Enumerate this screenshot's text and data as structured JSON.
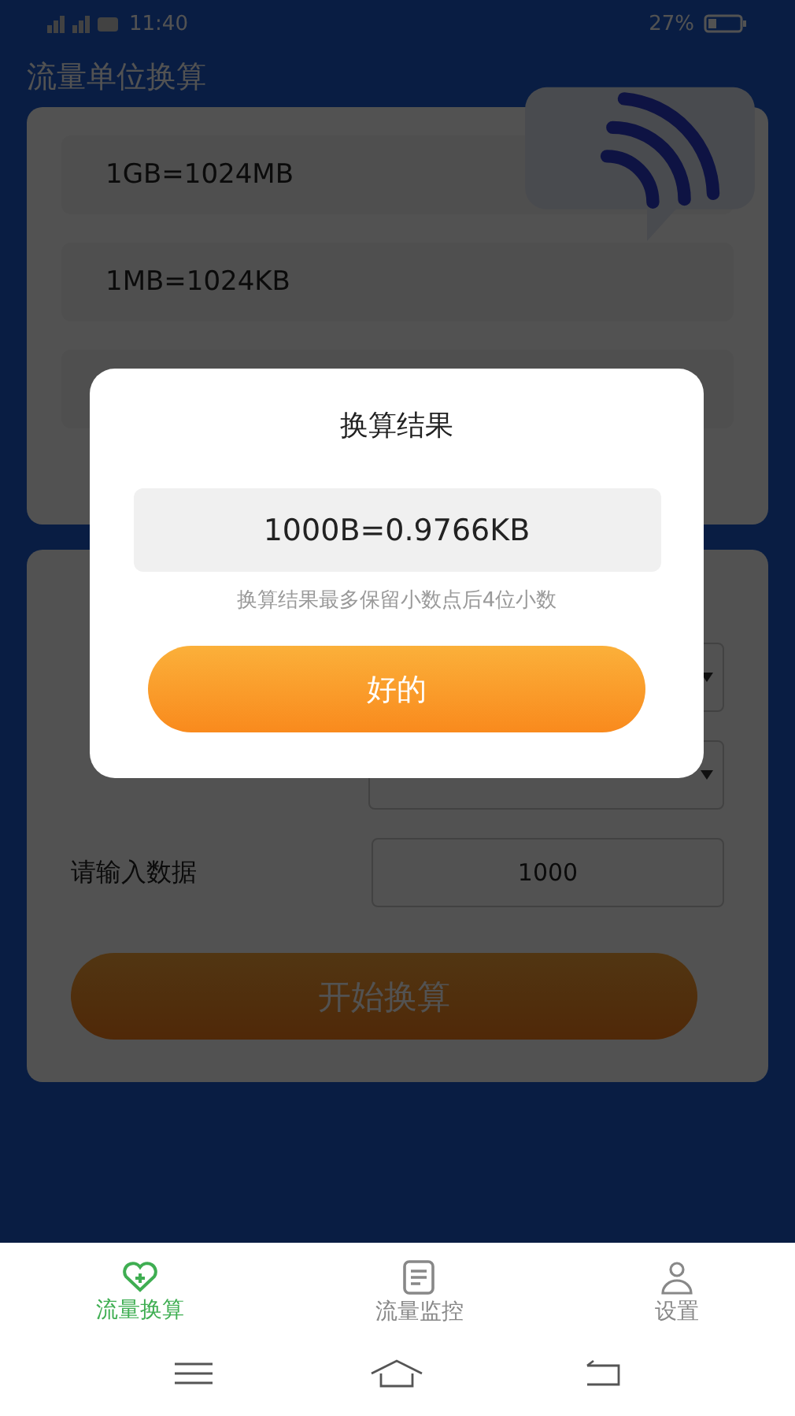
{
  "status_bar": {
    "time": "11:40",
    "battery": "27%"
  },
  "title": "流量单位换算",
  "units": [
    "1GB=1024MB",
    "1MB=1024KB"
  ],
  "converter": {
    "rows": [
      {
        "kind": "select"
      },
      {
        "kind": "select"
      },
      {
        "kind": "input",
        "label": "请输入数据",
        "value": "1000"
      }
    ],
    "button": "开始换算"
  },
  "dialog": {
    "title": "换算结果",
    "result": "1000B=0.9766KB",
    "note": "换算结果最多保留小数点后4位小数",
    "ok": "好的"
  },
  "tabs": [
    {
      "label": "流量换算",
      "selected": true
    },
    {
      "label": "流量监控",
      "selected": false
    },
    {
      "label": "设置",
      "selected": false
    }
  ]
}
